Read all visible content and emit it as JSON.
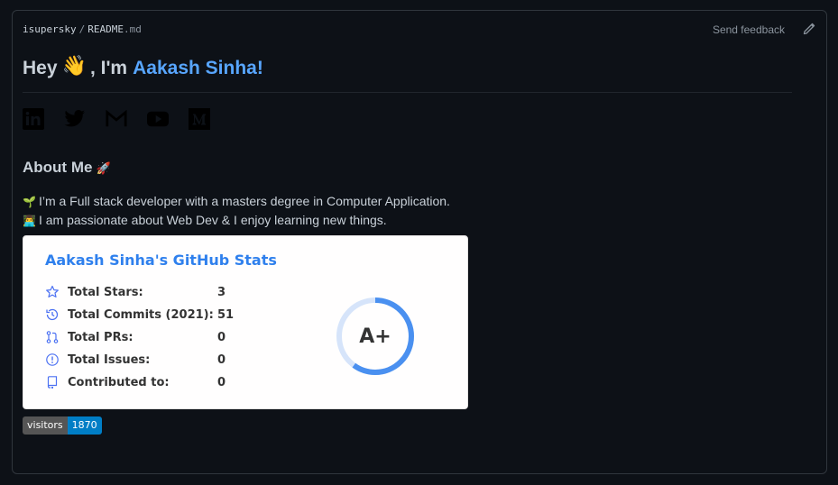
{
  "breadcrumb": {
    "owner": "isupersky",
    "separator": "/",
    "file_base": "README",
    "file_ext": ".md"
  },
  "feedback_label": "Send feedback",
  "heading": {
    "prefix": "Hey",
    "wave": "👋",
    "middle": ", I'm",
    "name": "Aakash Sinha!"
  },
  "socials": [
    "linkedin-icon",
    "twitter-icon",
    "gmail-icon",
    "youtube-icon",
    "medium-icon"
  ],
  "about": {
    "title": "About Me",
    "emoji": "🚀"
  },
  "bio": [
    {
      "emoji": "🌱",
      "text": "I’m a Full stack developer with a masters degree in Computer Application."
    },
    {
      "emoji": "👨‍💻",
      "text": "I am passionate about Web Dev & I enjoy learning new things."
    }
  ],
  "stats": {
    "title": "Aakash Sinha's GitHub Stats",
    "rows": [
      {
        "icon": "star-icon",
        "label": "Total Stars:",
        "value": "3"
      },
      {
        "icon": "history-icon",
        "label": "Total Commits (2021):",
        "value": "51"
      },
      {
        "icon": "pull-request-icon",
        "label": "Total PRs:",
        "value": "0"
      },
      {
        "icon": "issue-icon",
        "label": "Total Issues:",
        "value": "0"
      },
      {
        "icon": "repo-icon",
        "label": "Contributed to:",
        "value": "0"
      }
    ],
    "grade": "A+",
    "grade_progress": 0.6,
    "accent": "#2f80ed"
  },
  "visitors": {
    "label": "visitors",
    "count": "1870"
  },
  "colors": {
    "background": "#0d1117",
    "link": "#58a6ff",
    "text": "#c9d1d9",
    "badge_blue": "#007ec6"
  }
}
